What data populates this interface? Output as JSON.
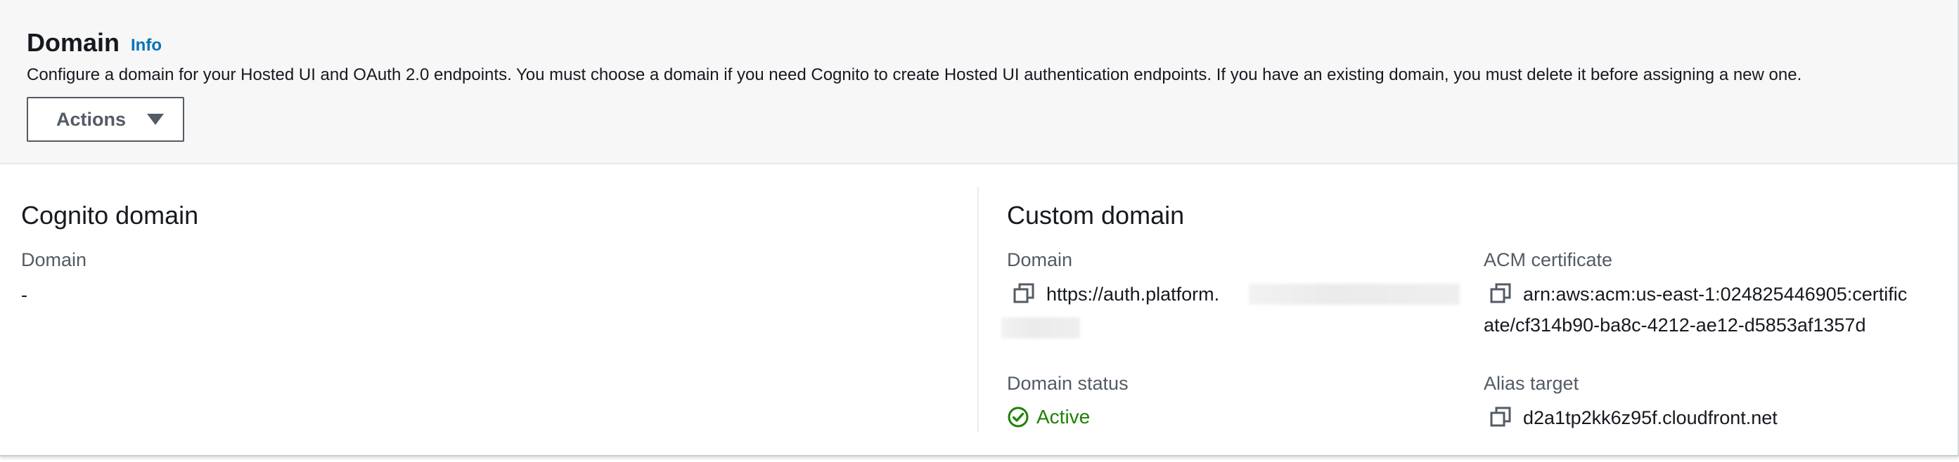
{
  "header": {
    "title": "Domain",
    "info_label": "Info",
    "description": "Configure a domain for your Hosted UI and OAuth 2.0 endpoints. You must choose a domain if you need Cognito to create Hosted UI authentication endpoints. If you have an existing domain, you must delete it before assigning a new one.",
    "actions_label": "Actions"
  },
  "cognito_domain": {
    "title": "Cognito domain",
    "domain_label": "Domain",
    "domain_value": "-"
  },
  "custom_domain": {
    "title": "Custom domain",
    "domain_label": "Domain",
    "domain_value": "https://auth.platform.",
    "acm_label": "ACM certificate",
    "acm_value_line1": "arn:aws:acm:us-east-1:024825446905:certific",
    "acm_value_line2": "ate/cf314b90-ba8c-4212-ae12-d5853af1357d",
    "status_label": "Domain status",
    "status_value": "Active",
    "alias_label": "Alias target",
    "alias_value": "d2a1tp2kk6z95f.cloudfront.net"
  },
  "colors": {
    "link": "#0073bb",
    "success": "#1d8102",
    "header_bg": "#f7f7f7"
  },
  "icons": [
    "copy-icon",
    "caret-down-icon",
    "check-circle-icon"
  ]
}
